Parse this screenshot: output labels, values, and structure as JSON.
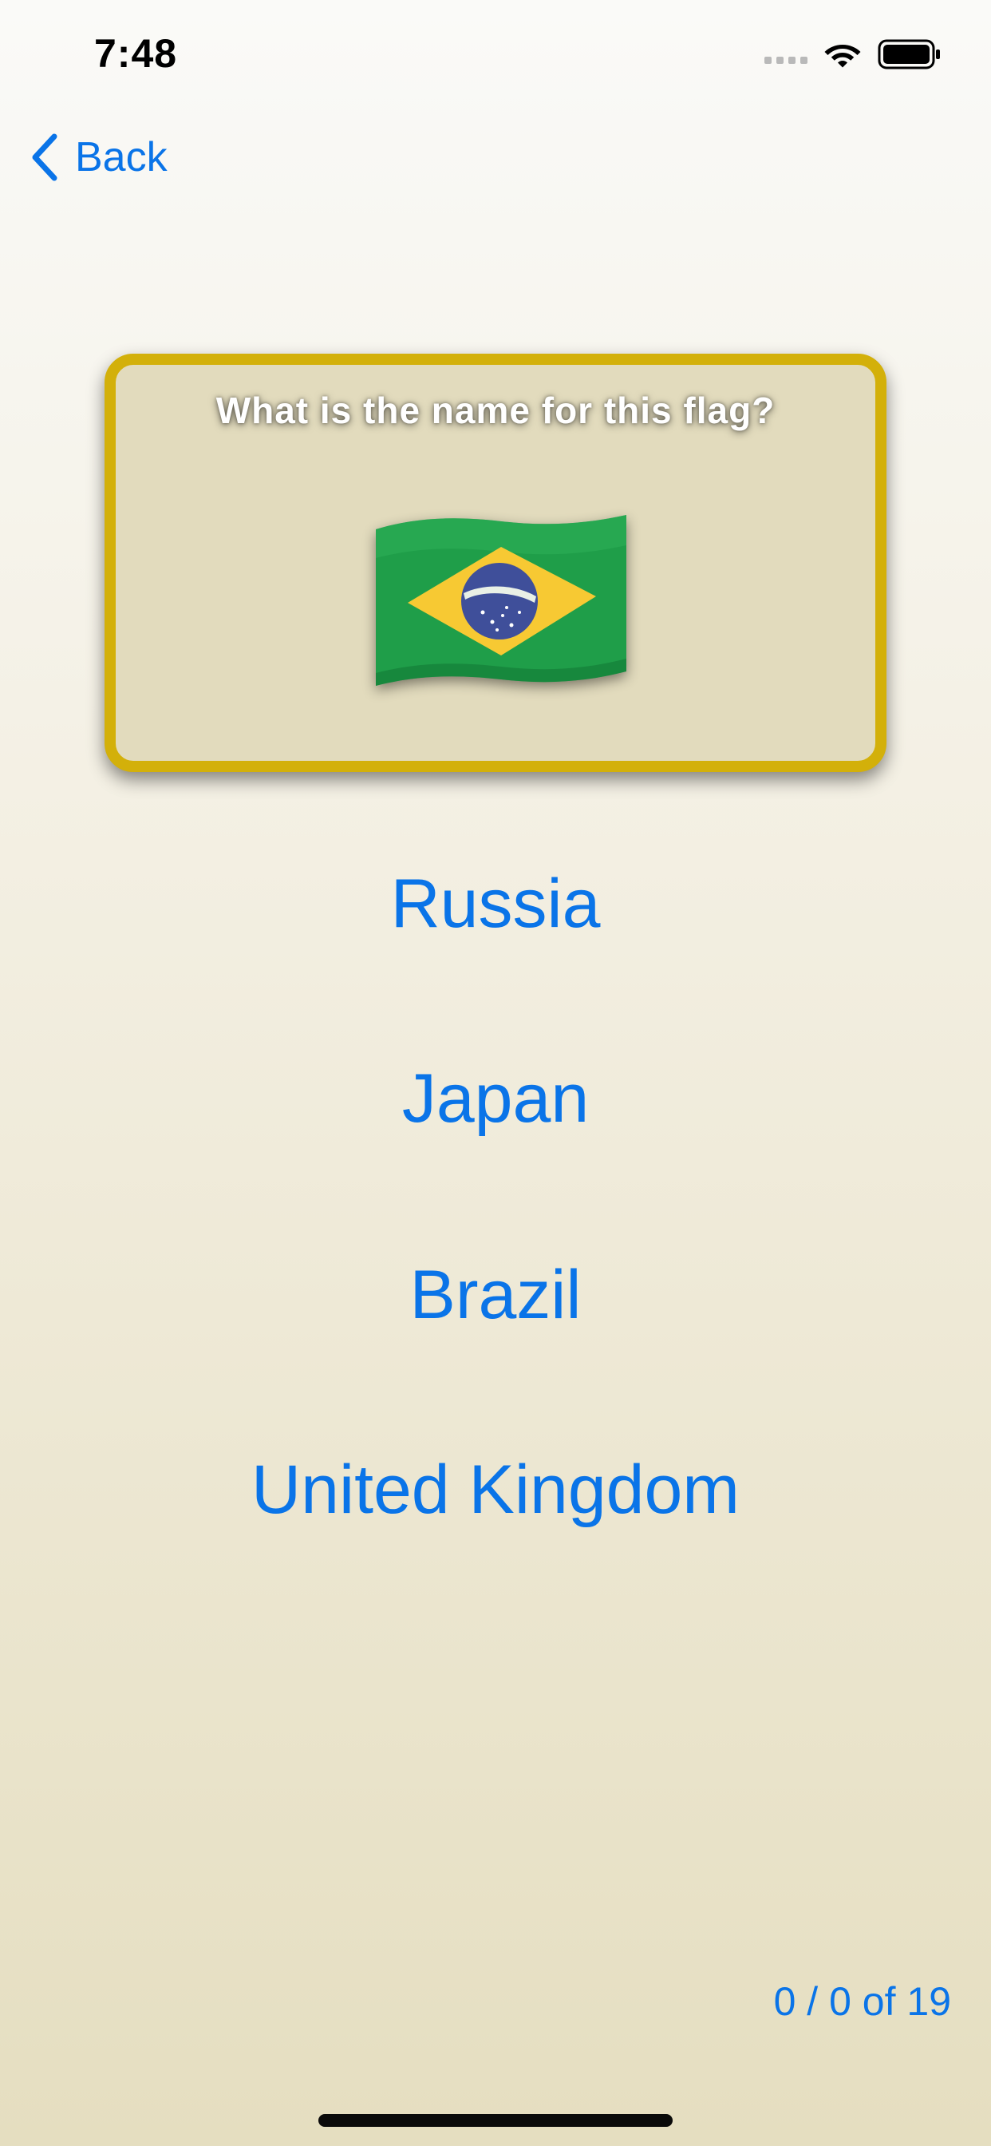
{
  "status_bar": {
    "time": "7:48"
  },
  "navigation": {
    "back_label": "Back"
  },
  "question": {
    "prompt": "What is the name for this flag?",
    "flag_icon": "brazil-flag-icon"
  },
  "answers": [
    {
      "label": "Russia"
    },
    {
      "label": "Japan"
    },
    {
      "label": "Brazil"
    },
    {
      "label": "United Kingdom"
    }
  ],
  "score": {
    "text": "0 / 0 of 19"
  },
  "colors": {
    "accent": "#0a74e8",
    "card_border": "#d3b00a",
    "card_fill": "#e2dbbd",
    "flag_green": "#1f9e49",
    "flag_yellow": "#f7c933",
    "flag_blue": "#3f4f9a"
  }
}
